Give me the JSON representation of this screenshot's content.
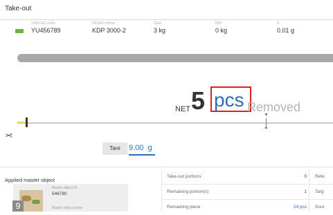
{
  "window": {
    "title": "Take-out"
  },
  "device_info": {
    "internal_code_label": "Internal code",
    "internal_code": "YU456789",
    "model_name_label": "Model name",
    "model_name": "KDP 3000-2",
    "max_label": "Max",
    "max": "3 kg",
    "min_label": "Min",
    "min": "0 kg",
    "d_label": "d",
    "d": "0.01 g",
    "accent_color": "#6db33f"
  },
  "reading": {
    "net_label": "NET",
    "value": "5",
    "unit": "pcs",
    "status": "Removed",
    "unit_color": "#2b6cb8",
    "highlight_color": "#d9221c"
  },
  "progress": {
    "level_fraction": 0.02,
    "scissors_icon": "scissors-icon",
    "threshold_marker_icon": "threshold-marker-icon"
  },
  "tare": {
    "label": "Tare",
    "value": "9.00",
    "unit": "g"
  },
  "applied_master": {
    "heading": "Applied master object",
    "id_label": "Master object ID",
    "id_value": "546780",
    "name_label": "Master object name",
    "badge": "9"
  },
  "stats": {
    "rows": [
      {
        "label": "Take-out portions",
        "value": "0",
        "extra": "Refe"
      },
      {
        "label": "Remaining portion(s)",
        "value": "1",
        "extra": "Targ"
      },
      {
        "label": "Remaining piece",
        "value": "24 pcs",
        "extra": "Sour"
      }
    ]
  }
}
